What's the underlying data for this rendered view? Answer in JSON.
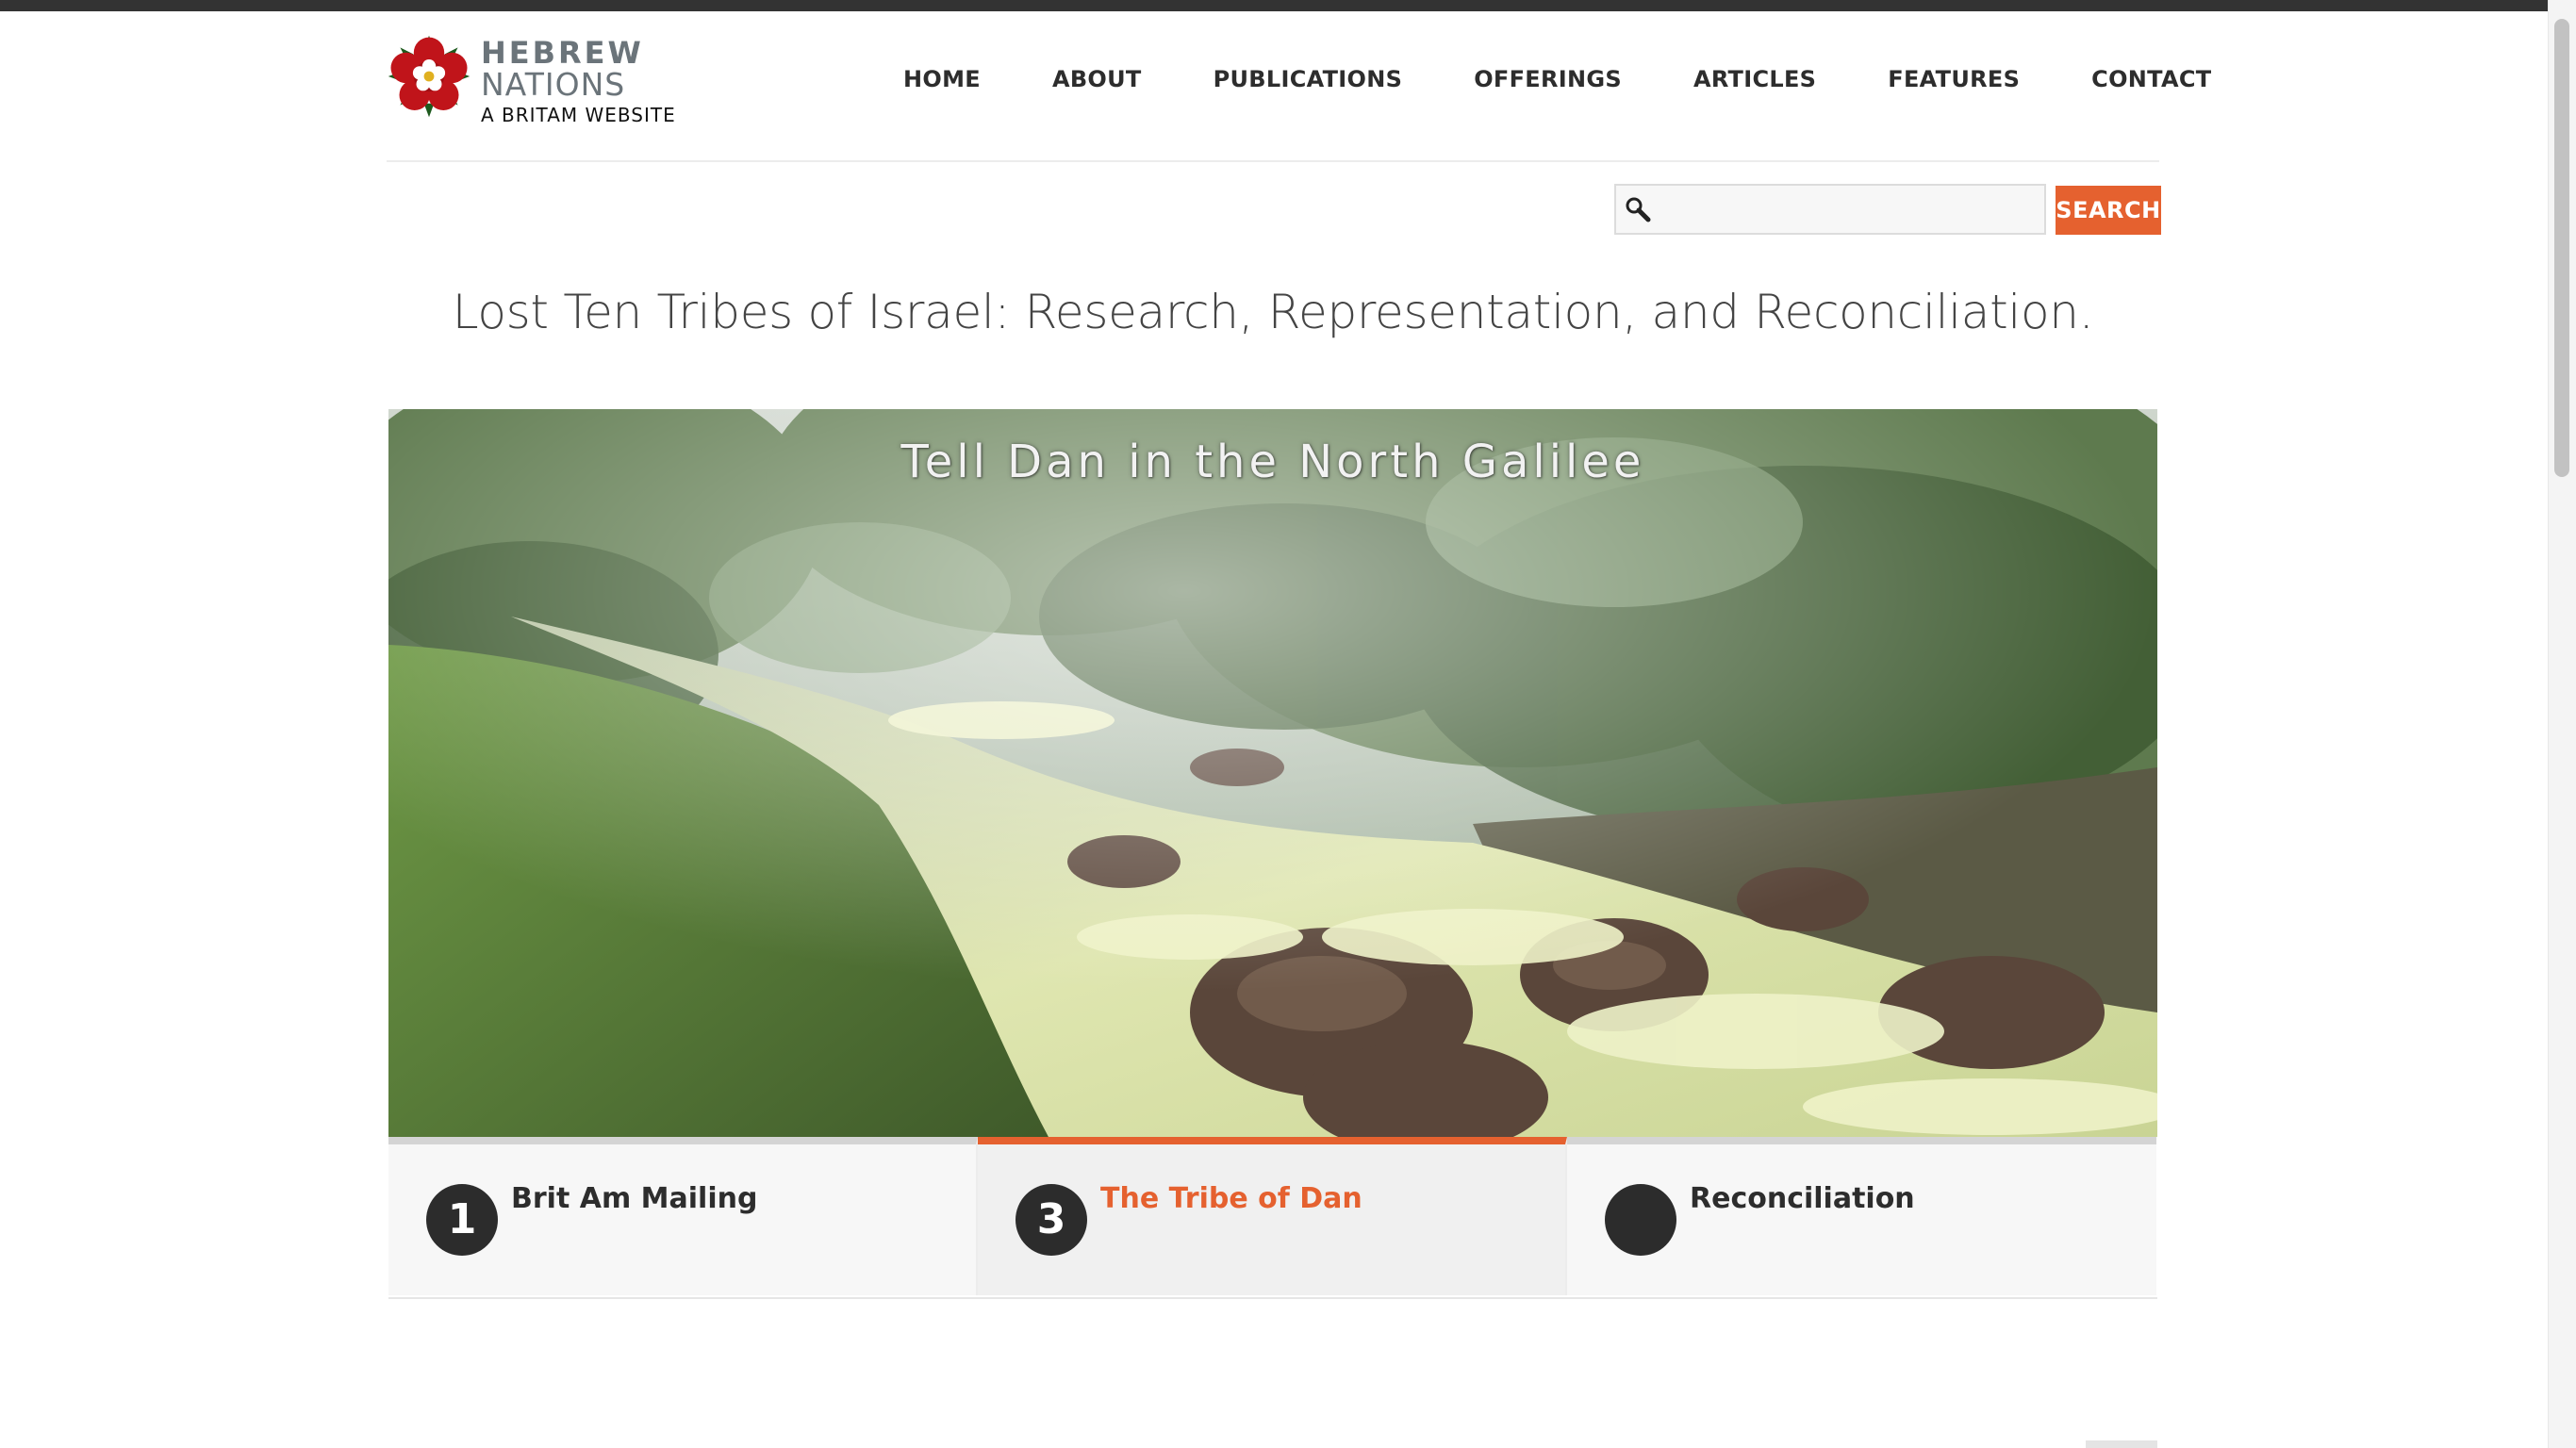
{
  "header": {
    "logo": {
      "line1": "HEBREW",
      "line2": "NATIONS",
      "tagline": "A BRITAM WEBSITE"
    },
    "nav": [
      {
        "label": "HOME"
      },
      {
        "label": "ABOUT"
      },
      {
        "label": "PUBLICATIONS"
      },
      {
        "label": "OFFERINGS"
      },
      {
        "label": "ARTICLES"
      },
      {
        "label": "FEATURES"
      },
      {
        "label": "CONTACT"
      }
    ]
  },
  "search": {
    "value": "",
    "placeholder": "",
    "button_label": "SEARCH"
  },
  "tagline": "Lost Ten Tribes of Israel: Research, Representation, and Reconciliation.",
  "slider": {
    "caption": "Tell Dan in the North Galilee",
    "tabs": [
      {
        "number": "1",
        "label": "Brit Am Mailing",
        "active": false
      },
      {
        "number": "3",
        "label": "The Tribe of Dan",
        "active": true
      },
      {
        "number": "",
        "label": "Reconciliation",
        "active": false
      }
    ]
  },
  "colors": {
    "accent": "#e5612f",
    "top_bar": "#333333",
    "text": "#2d2d2d"
  }
}
